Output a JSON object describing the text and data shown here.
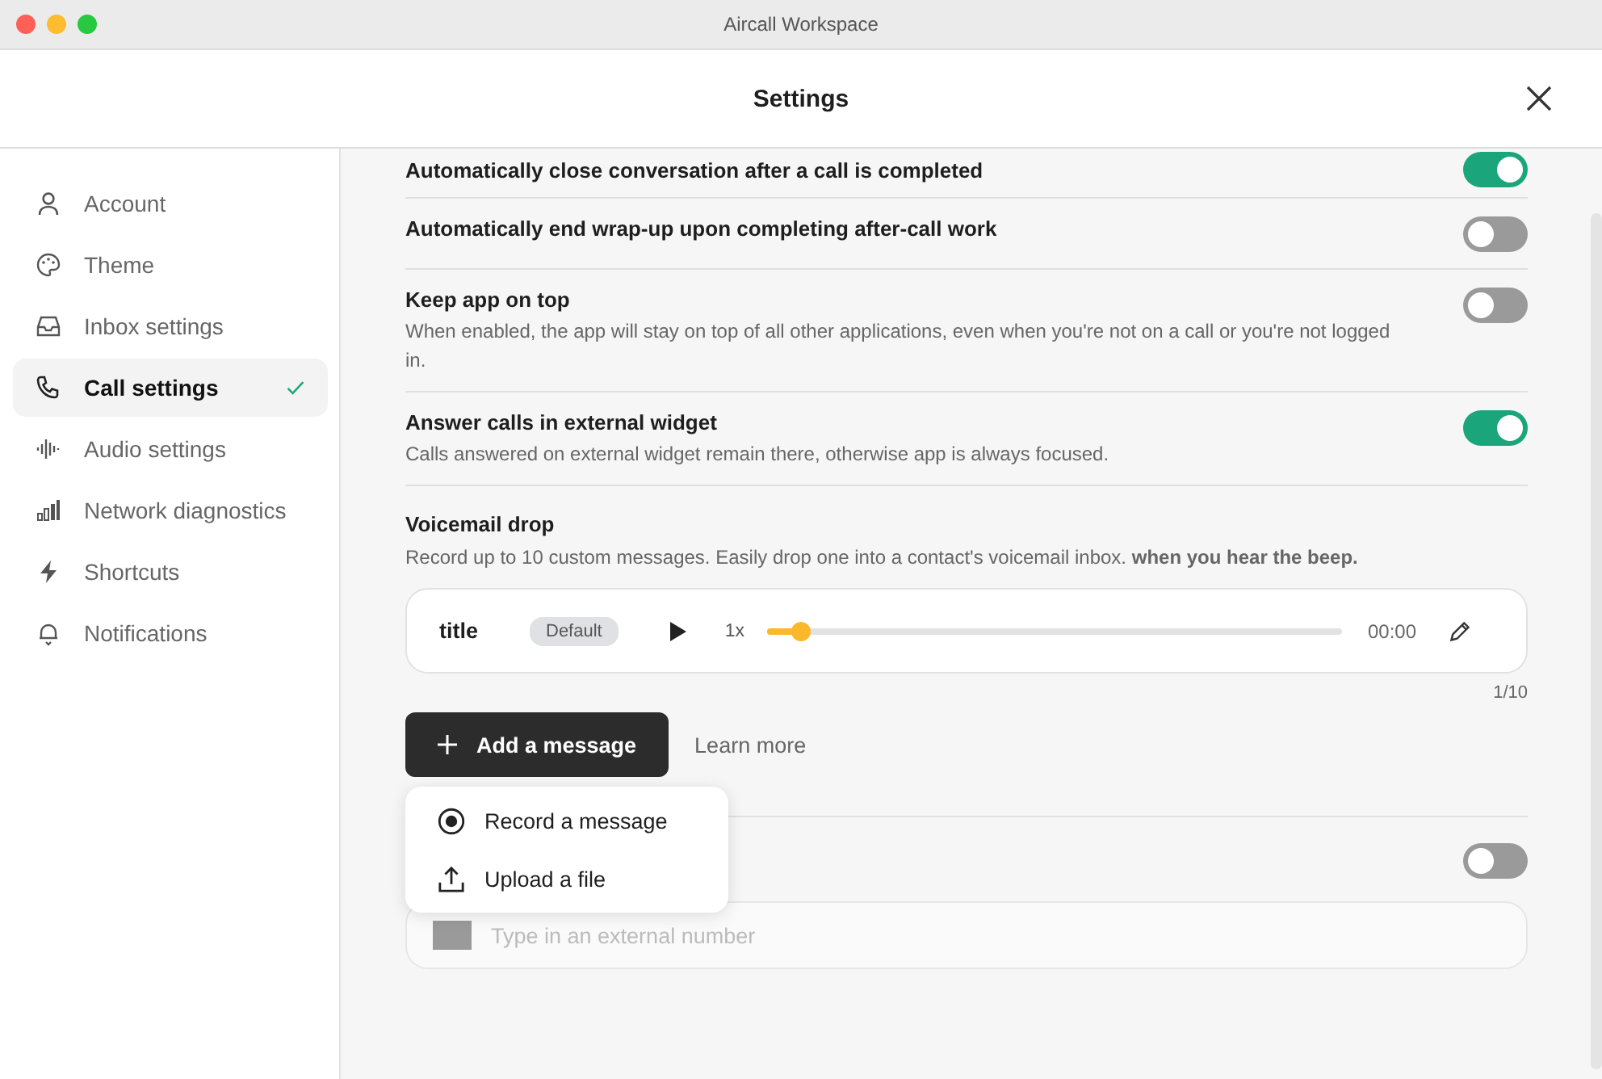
{
  "window": {
    "title": "Aircall Workspace"
  },
  "header": {
    "title": "Settings"
  },
  "sidebar": {
    "items": [
      {
        "label": "Account",
        "kind": "person",
        "selected": false
      },
      {
        "label": "Theme",
        "kind": "palette",
        "selected": false
      },
      {
        "label": "Inbox settings",
        "kind": "inbox",
        "selected": false
      },
      {
        "label": "Call settings",
        "kind": "phone",
        "selected": true
      },
      {
        "label": "Audio settings",
        "kind": "wave",
        "selected": false
      },
      {
        "label": "Network diagnostics",
        "kind": "bars",
        "selected": false
      },
      {
        "label": "Shortcuts",
        "kind": "bolt",
        "selected": false
      },
      {
        "label": "Notifications",
        "kind": "bell",
        "selected": false
      }
    ]
  },
  "settings": [
    {
      "title": "Automatically close conversation after a call is completed",
      "on": true
    },
    {
      "title": "Automatically end wrap-up upon completing after-call work",
      "on": false
    },
    {
      "title": "Keep app on top",
      "description": "When enabled, the app will stay on top of all other applications, even when you're not on a call or you're not logged in.",
      "on": false
    },
    {
      "title": "Answer calls in external widget",
      "description": "Calls answered on external widget remain there, otherwise app is always focused.",
      "on": true
    }
  ],
  "voicemail": {
    "title": "Voicemail drop",
    "description": "Record up to 10 custom messages. Easily drop one into a contact's voicemail inbox. **when you hear the beep.**",
    "messages": [
      {
        "title": "title",
        "badge": "Default",
        "speed": "1x",
        "level": 0.06,
        "time": "00:00"
      }
    ],
    "count": "1/10",
    "add_button": "Add a message",
    "learn_more": "Learn more"
  },
  "menu": {
    "items": [
      {
        "label": "Record a message",
        "kind": "record"
      },
      {
        "label": "Upload a file",
        "kind": "upload"
      }
    ]
  },
  "forwarding": {
    "on": false,
    "placeholder": "Type in an external number"
  }
}
